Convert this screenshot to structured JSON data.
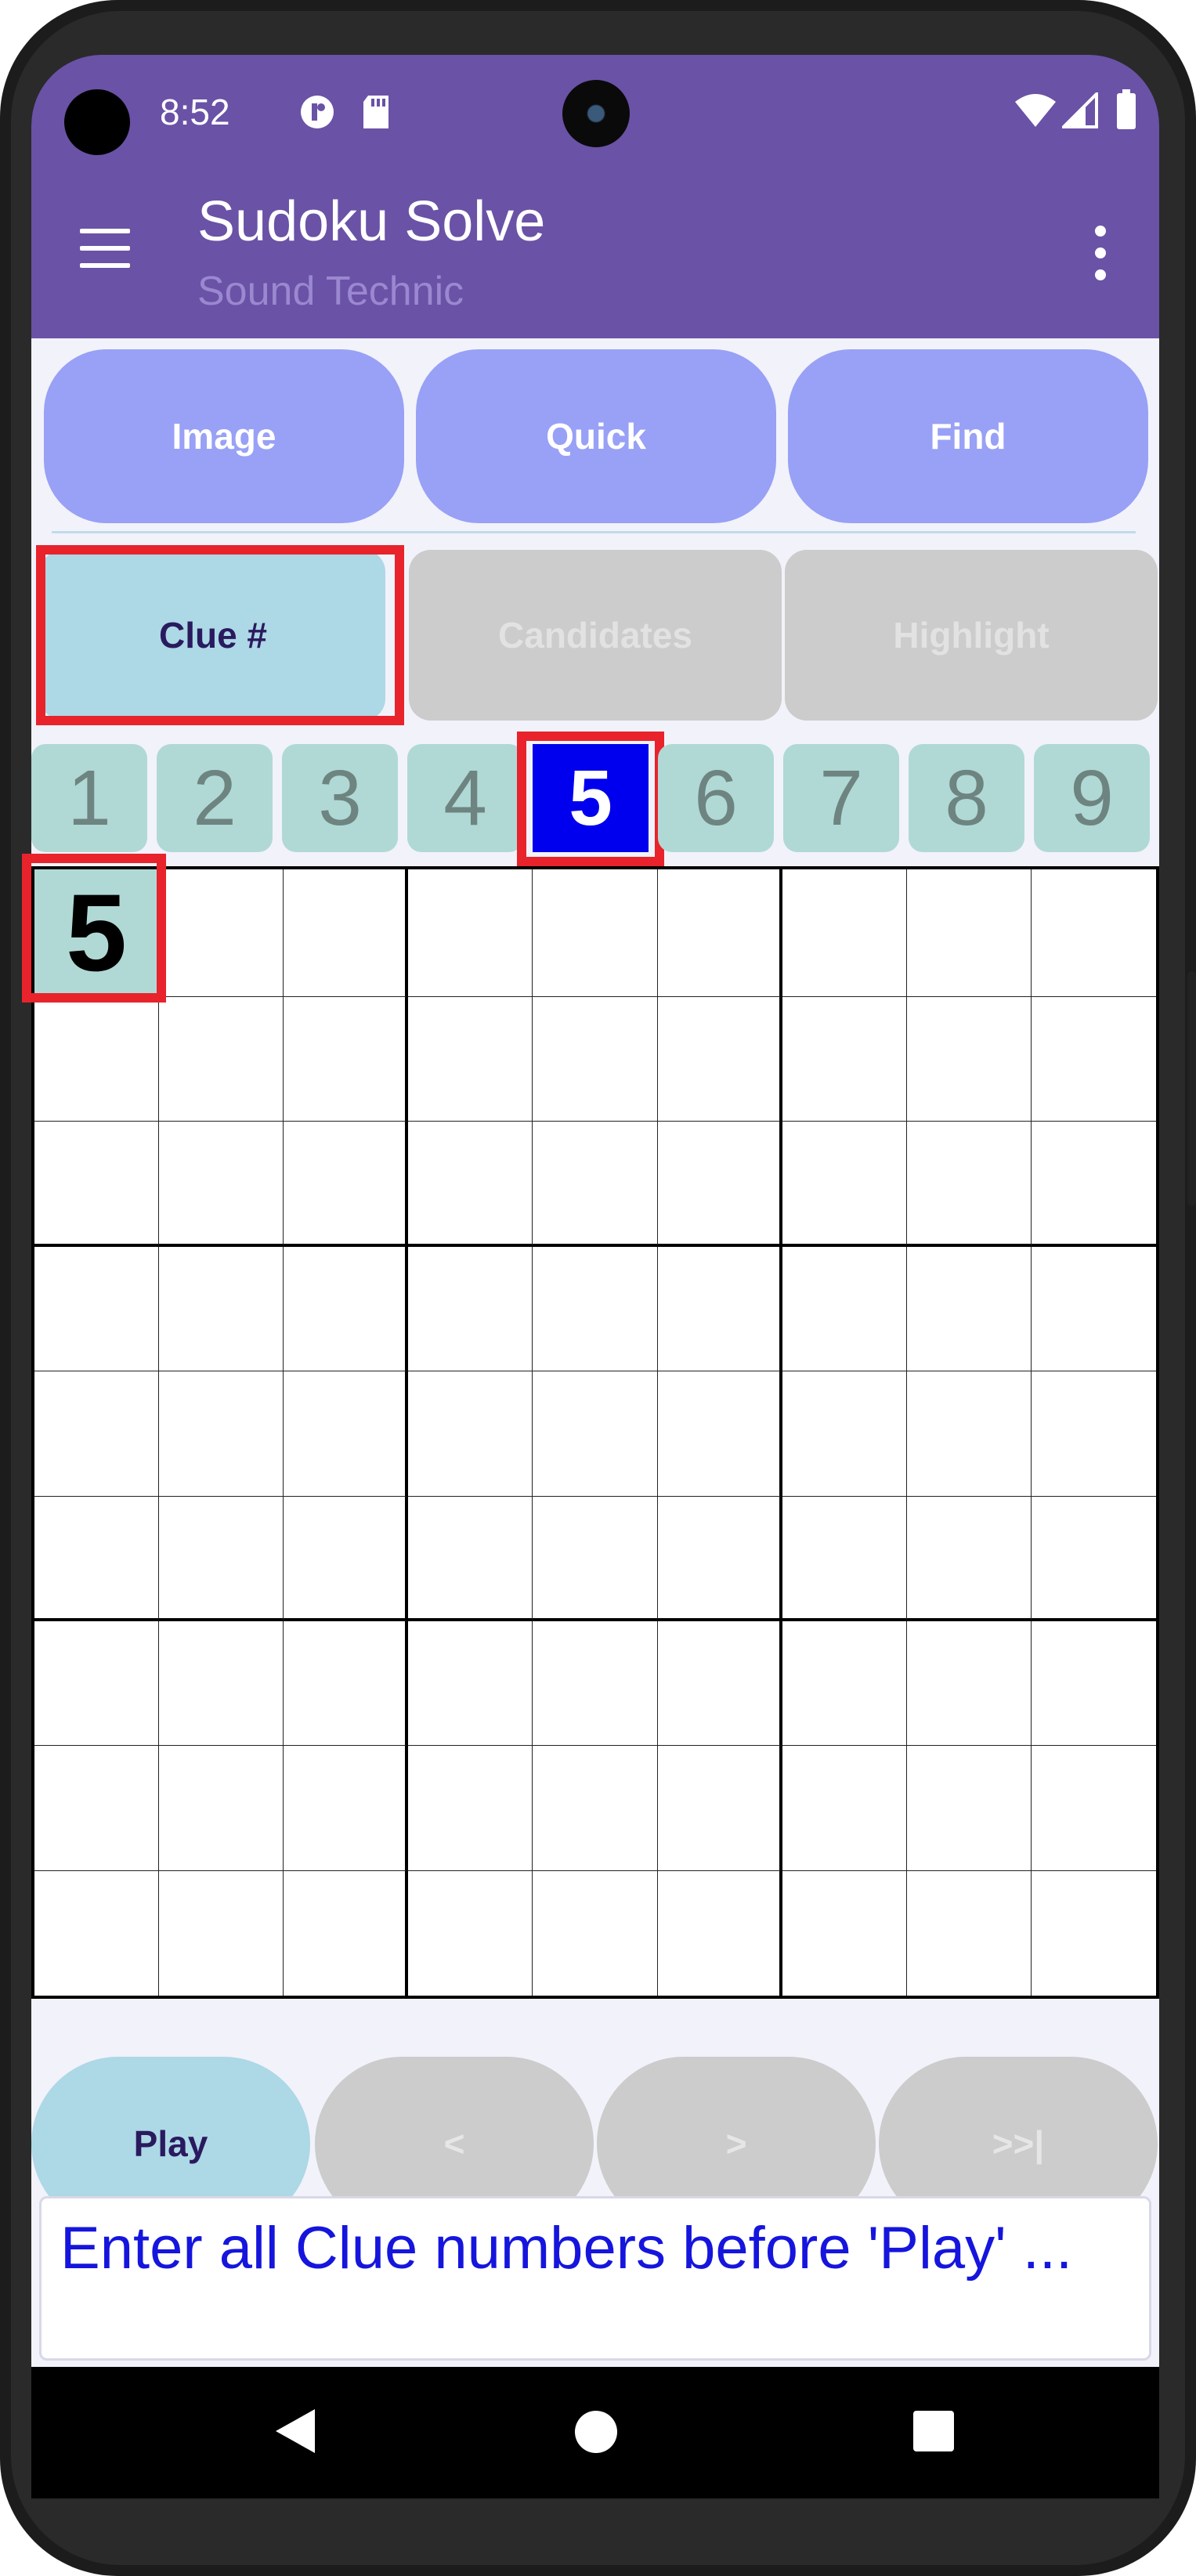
{
  "status_bar": {
    "time": "8:52",
    "icons_left": [
      "data-saver-icon",
      "sd-card-icon"
    ],
    "icons_right": [
      "wifi-icon",
      "signal-icon",
      "battery-icon"
    ]
  },
  "app_bar": {
    "title": "Sudoku Solve",
    "subtitle": "Sound Technic",
    "menu_icon": "hamburger-menu-icon",
    "more_icon": "more-vertical-icon"
  },
  "top_buttons": [
    {
      "label": "Image"
    },
    {
      "label": "Quick"
    },
    {
      "label": "Find"
    }
  ],
  "mode_tabs": [
    {
      "label": "Clue #",
      "state": "active"
    },
    {
      "label": "Candidates",
      "state": "disabled"
    },
    {
      "label": "Highlight",
      "state": "disabled"
    }
  ],
  "number_keys": [
    "1",
    "2",
    "3",
    "4",
    "5",
    "6",
    "7",
    "8",
    "9"
  ],
  "selected_number": "5",
  "grid": {
    "rows": [
      [
        "5",
        "",
        "",
        "",
        "",
        "",
        "",
        "",
        ""
      ],
      [
        "",
        "",
        "",
        "",
        "",
        "",
        "",
        "",
        ""
      ],
      [
        "",
        "",
        "",
        "",
        "",
        "",
        "",
        "",
        ""
      ],
      [
        "",
        "",
        "",
        "",
        "",
        "",
        "",
        "",
        ""
      ],
      [
        "",
        "",
        "",
        "",
        "",
        "",
        "",
        "",
        ""
      ],
      [
        "",
        "",
        "",
        "",
        "",
        "",
        "",
        "",
        ""
      ],
      [
        "",
        "",
        "",
        "",
        "",
        "",
        "",
        "",
        ""
      ],
      [
        "",
        "",
        "",
        "",
        "",
        "",
        "",
        "",
        ""
      ],
      [
        "",
        "",
        "",
        "",
        "",
        "",
        "",
        "",
        ""
      ]
    ]
  },
  "bottom_buttons": [
    {
      "label": "Play",
      "state": "active"
    },
    {
      "label": "<",
      "state": "disabled"
    },
    {
      "label": ">",
      "state": "disabled"
    },
    {
      "label": ">>|",
      "state": "disabled"
    }
  ],
  "message": "Enter all Clue numbers before 'Play' ...",
  "colors": {
    "app_bar": "#6a52a6",
    "primary_button": "#98a1f5",
    "active_button": "#add8e6",
    "disabled_button": "#cccccc",
    "number_key": "#b0d9d6",
    "selected_key": "#0000ee",
    "highlight_box": "#e8232c",
    "message_text": "#1515dd"
  }
}
